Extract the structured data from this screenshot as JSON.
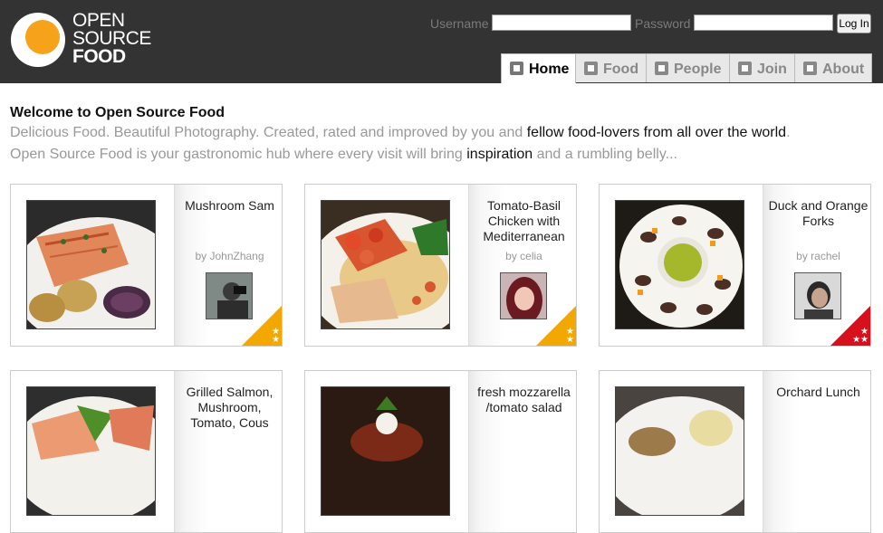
{
  "logo": {
    "line1": "OPEN",
    "line2": "SOURCE",
    "line3": "FOOD"
  },
  "login": {
    "username_label": "Username",
    "password_label": "Password",
    "login_button": "Log In"
  },
  "tabs": [
    {
      "label": "Home",
      "icon": "home-icon"
    },
    {
      "label": "Food",
      "icon": "food-list-icon"
    },
    {
      "label": "People",
      "icon": "people-icon"
    },
    {
      "label": "Join",
      "icon": "checkbox-icon"
    },
    {
      "label": "About",
      "icon": "question-icon"
    }
  ],
  "welcome": {
    "title": "Welcome to Open Source Food",
    "line1_a": "Delicious Food. Beautiful Photography. Created, rated and improved by you and ",
    "line1_link": "fellow food-lovers from all over the world",
    "line1_b": ".",
    "line2_a": "Open Source Food is your gastronomic hub where every visit will bring ",
    "line2_link": "inspiration",
    "line2_b": " and a rumbling belly..."
  },
  "cards": [
    {
      "title": "Mushroom Sam",
      "author": "by JohnZhang",
      "rating_color": "#f2a800",
      "stars": 2
    },
    {
      "title": "Tomato-Basil Chicken with Mediterranean",
      "author": "by celia",
      "rating_color": "#f2a800",
      "stars": 2
    },
    {
      "title": "Duck and Orange Forks",
      "author": "by rachel",
      "rating_color": "#d7101e",
      "stars": 3
    },
    {
      "title": "Grilled Salmon, Mushroom, Tomato, Cous",
      "author": "",
      "rating_color": "",
      "stars": 0
    },
    {
      "title": "fresh mozzarella /tomato salad",
      "author": "",
      "rating_color": "",
      "stars": 0
    },
    {
      "title": "Orchard Lunch",
      "author": "",
      "rating_color": "",
      "stars": 0
    }
  ],
  "colors": {
    "header_bg": "#333333",
    "logo_yolk": "#f7a21b"
  }
}
